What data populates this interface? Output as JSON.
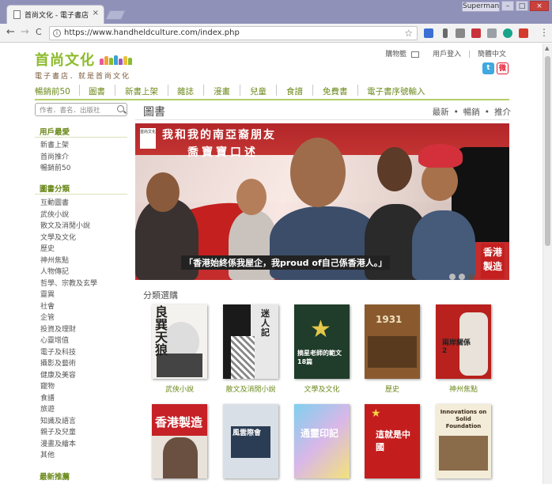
{
  "browser": {
    "tab_title": "首尚文化 - 電子書店 - 點",
    "tab_close": "×",
    "user": "Superman",
    "window_controls": {
      "minimize": "–",
      "maximize": "□",
      "close": "×"
    },
    "nav": {
      "back": "←",
      "forward": "→",
      "reload": "C"
    },
    "url": "https://www.handheldculture.com/index.php",
    "bookmark_icon": "☆",
    "menu_icon": "⋮"
  },
  "header": {
    "logo_main": "首尚文化",
    "logo_tagline": "電子書店．就是首尚文化",
    "links": {
      "cart": "購物籃",
      "login": "用戶登入",
      "lang": "簡體中文"
    },
    "social": {
      "twitter": "t",
      "weibo": "微"
    }
  },
  "main_nav": [
    "暢銷前50",
    "圖書",
    "新書上架",
    "雜誌",
    "漫畫",
    "兒童",
    "食譜",
    "免費書",
    "電子書序號輸入"
  ],
  "sidebar": {
    "search_placeholder": "作者．書名．出版社",
    "user_section": {
      "title": "用戶最愛",
      "items": [
        "新書上架",
        "首尚推介",
        "暢銷前50"
      ]
    },
    "category_section": {
      "title": "圖書分類",
      "items": [
        "互動圖書",
        "武俠小說",
        "散文及消閒小說",
        "文學及文化",
        "歷史",
        "神州焦點",
        "人物傳記",
        "哲學、宗教及玄學",
        "靈異",
        "社會",
        "企管",
        "投資及理財",
        "心靈增值",
        "電子及科技",
        "攝影及藝術",
        "健康及美容",
        "寵物",
        "食譜",
        "旅遊",
        "知識及語言",
        "親子及兒童",
        "漫畫及繪本",
        "其他"
      ]
    },
    "latest_section": {
      "title": "最新推薦"
    }
  },
  "content": {
    "section_title": "圖書",
    "tabs": [
      "最新",
      "暢銷",
      "推介"
    ],
    "tab_separator": "•",
    "banner": {
      "title": "我和我的南亞裔朋友",
      "subtitle": "喬寶寶口述",
      "publisher": "首尚文化",
      "quote": "「香港始終係我屋企，我proud of自己係香港人。」",
      "badge": "香港製造"
    },
    "category_heading": "分類選購",
    "books_row1": [
      {
        "caption": "武俠小說",
        "title": "良巽天狼"
      },
      {
        "caption": "散文及消閒小說",
        "title": "迷人記"
      },
      {
        "caption": "文學及文化",
        "title": "摘星老師的範文18篇"
      },
      {
        "caption": "歷史",
        "title": "1931"
      },
      {
        "caption": "神州焦點",
        "title": "兩岸關係2"
      }
    ],
    "books_row2": [
      {
        "title": "香港製造"
      },
      {
        "title": "風雲際會"
      },
      {
        "title": "通靈印記"
      },
      {
        "title": "這就是中國"
      },
      {
        "title": "Innovations on Solid Foundation"
      }
    ]
  },
  "colors": {
    "brand_green": "#8cbb2a",
    "link_green": "#6c8a1c",
    "banner_red": "#c3201f"
  }
}
